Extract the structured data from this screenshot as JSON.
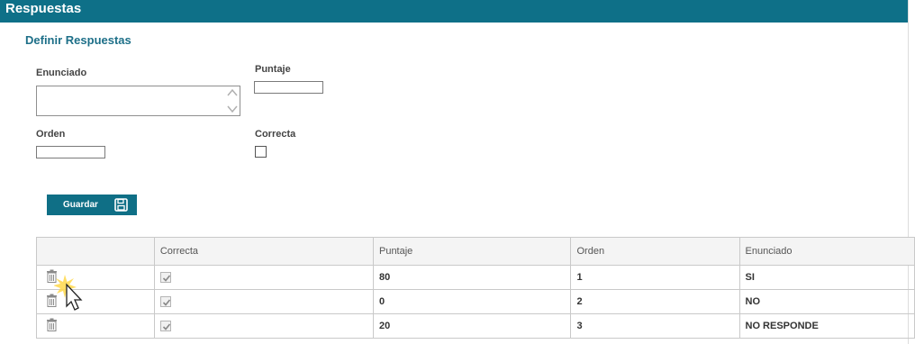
{
  "header": {
    "title": "Respuestas"
  },
  "section": {
    "title": "Definir Respuestas"
  },
  "form": {
    "enunciado_label": "Enunciado",
    "enunciado_value": "",
    "puntaje_label": "Puntaje",
    "puntaje_value": "",
    "orden_label": "Orden",
    "orden_value": "",
    "correcta_label": "Correcta",
    "correcta_checked": false
  },
  "toolbar": {
    "save_label": "Guardar",
    "save_icon": "floppy-disk-icon"
  },
  "table": {
    "columns": [
      "",
      "Correcta",
      "Puntaje",
      "Orden",
      "Enunciado"
    ],
    "rows": [
      {
        "correcta": true,
        "puntaje": "80",
        "orden": "1",
        "enunciado": "SI"
      },
      {
        "correcta": true,
        "puntaje": "0",
        "orden": "2",
        "enunciado": "NO"
      },
      {
        "correcta": true,
        "puntaje": "20",
        "orden": "3",
        "enunciado": "NO RESPONDE"
      }
    ],
    "row_action_icon": "trash-icon"
  },
  "colors": {
    "header_bg": "#0e7088",
    "title_text": "#1d6f88",
    "button_bg": "#0f6f86"
  }
}
